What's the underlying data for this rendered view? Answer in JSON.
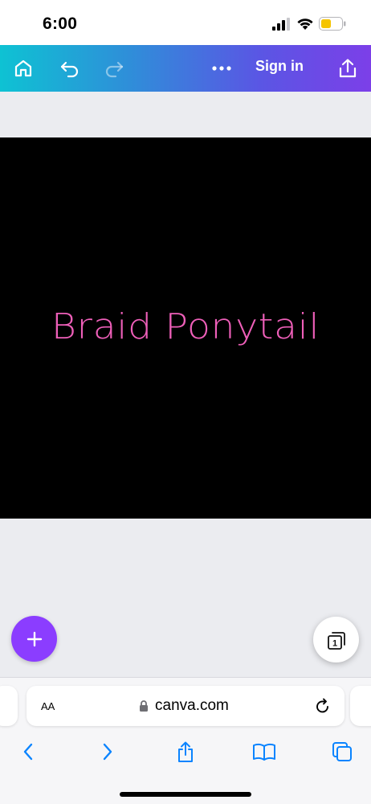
{
  "status_bar": {
    "time": "6:00",
    "battery_color": "#f5c400"
  },
  "toolbar": {
    "home_icon": "home-icon",
    "undo_icon": "undo-icon",
    "redo_icon": "redo-icon",
    "more_icon": "more-icon",
    "signin_label": "Sign in",
    "share_icon": "share-icon",
    "gradient_start": "#0ec2d3",
    "gradient_end": "#7c3fe8"
  },
  "design": {
    "background": "#000000",
    "text": "Braid Ponytail",
    "text_color": "#ee5fb9"
  },
  "fab": {
    "add_icon": "plus-icon",
    "add_color": "#8b3dff",
    "page_count": "1"
  },
  "browser": {
    "text_size_label": "AA",
    "url": "canva.com",
    "lock_icon": "lock-icon",
    "reload_icon": "reload-icon",
    "accent": "#0a84ff",
    "nav": [
      "back-icon",
      "forward-icon",
      "share-icon",
      "bookmarks-icon",
      "tabs-icon"
    ]
  }
}
